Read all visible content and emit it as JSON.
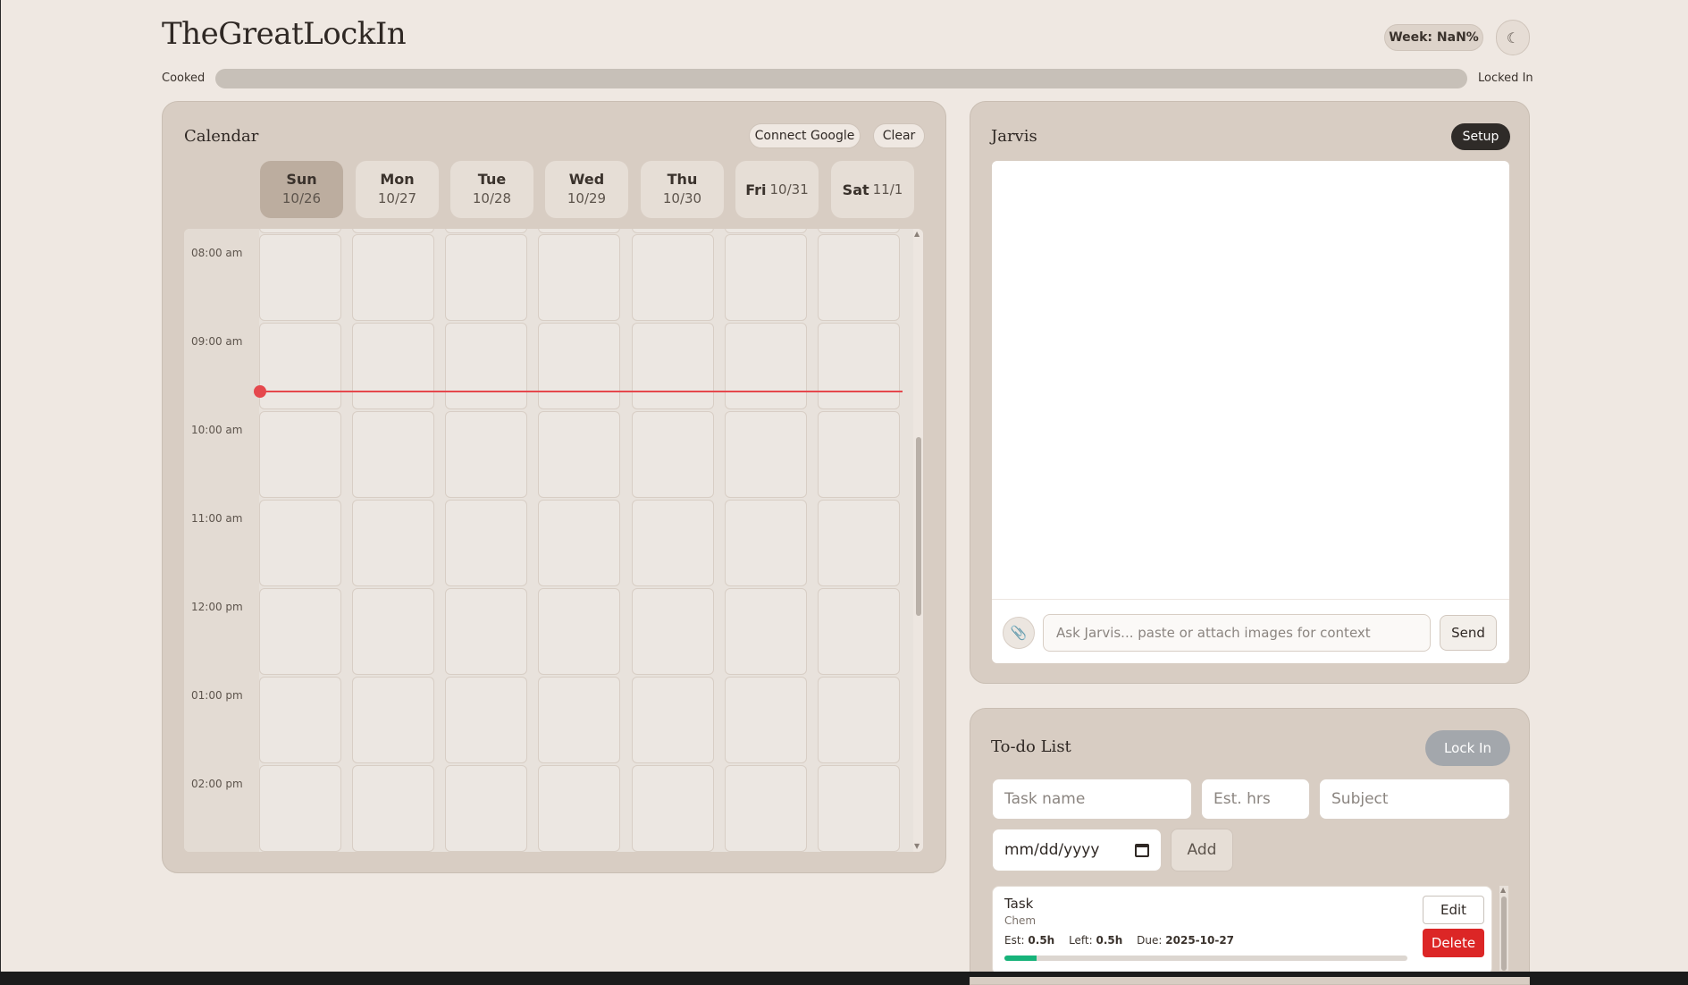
{
  "header": {
    "brand": "TheGreatLockIn",
    "week_badge": "Week: NaN%",
    "theme_toggle_glyph": "☾",
    "meter": {
      "left_label": "Cooked",
      "right_label": "Locked In",
      "progress": 0
    }
  },
  "calendar": {
    "title": "Calendar",
    "connect_label": "Connect Google",
    "clear_label": "Clear",
    "days": [
      {
        "name": "Sun",
        "date": "10/26"
      },
      {
        "name": "Mon",
        "date": "10/27"
      },
      {
        "name": "Tue",
        "date": "10/28"
      },
      {
        "name": "Wed",
        "date": "10/29"
      },
      {
        "name": "Thu",
        "date": "10/30"
      },
      {
        "name": "Fri",
        "date": "10/31"
      },
      {
        "name": "Sat",
        "date": "11/1"
      }
    ],
    "times": [
      "08:00 am",
      "09:00 am",
      "10:00 am",
      "11:00 am",
      "12:00 pm",
      "01:00 pm",
      "02:00 pm"
    ]
  },
  "jarvis": {
    "title": "Jarvis",
    "setup_label": "Setup",
    "attach_icon": "paperclip-icon",
    "attach_glyph": "📎",
    "input_placeholder": "Ask Jarvis... paste or attach images for context",
    "send_label": "Send"
  },
  "todo": {
    "title": "To-do List",
    "lockin_label": "Lock In",
    "task_name_placeholder": "Task name",
    "est_placeholder": "Est. hrs",
    "subject_placeholder": "Subject",
    "date_placeholder": "mm/dd/yyyy",
    "add_label": "Add",
    "tasks": [
      {
        "name": "Task",
        "subject": "Chem",
        "est_label": "Est:",
        "est": "0.5h",
        "left_label": "Left:",
        "left": "0.5h",
        "due_label": "Due:",
        "due": "2025-10-27",
        "progress": 0.08,
        "edit_label": "Edit",
        "delete_label": "Delete"
      }
    ]
  },
  "colors": {
    "background": "#efe8e2",
    "panel": "#d8cdc3",
    "now_line": "#e5484d",
    "delete": "#dc2626",
    "progress": "#17b37a"
  }
}
